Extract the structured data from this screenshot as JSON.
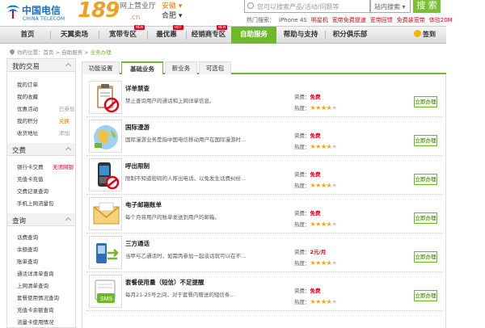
{
  "header": {
    "logo_cn": "中国电信",
    "logo_en": "CHINA TELECOM",
    "brand": "189",
    "brand_suffix": ".cn",
    "hall": "网上营业厅",
    "province": "安徽 ▾",
    "city": "合肥 ▾",
    "search_placeholder": "您可以搜索产品/活动/问题等",
    "search_scope": "站内搜索 ▾",
    "search_button": "搜 索",
    "hot_label": "热门搜索：",
    "hot_terms": [
      "iPhone 4S",
      "明星机",
      "宽带免费提速",
      "宽带回馈",
      "免费装宽带",
      "体验20M"
    ]
  },
  "nav": {
    "items": [
      "首页",
      "天翼卖场",
      "宽带专区",
      "最优惠",
      "经销商专区",
      "自助服务",
      "帮助与支持",
      "积分俱乐部"
    ],
    "tags": [
      "NEW",
      "HOT",
      "NEW"
    ],
    "sign": "签到"
  },
  "breadcrumb": {
    "prefix": "你的位置：首页 > 自助服务 > ",
    "current": "业务办理"
  },
  "sidebar": {
    "sections": [
      {
        "title": "我的交易",
        "links": [
          {
            "label": "我的订单",
            "note": ""
          },
          {
            "label": "我的收藏",
            "note": ""
          },
          {
            "label": "优惠活动",
            "note": "已参加"
          },
          {
            "label": "我的积分",
            "note": "兑换"
          },
          {
            "label": "收货地址",
            "note": "添加"
          }
        ]
      },
      {
        "title": "交费",
        "links": [
          {
            "label": "银行卡交费",
            "note": "无须网银"
          },
          {
            "label": "充值卡充值",
            "note": ""
          },
          {
            "label": "交费记录查询",
            "note": ""
          },
          {
            "label": "手机上网流量包",
            "note": ""
          }
        ]
      },
      {
        "title": "查询",
        "links": [
          {
            "label": "话费查询",
            "note": ""
          },
          {
            "label": "余额查询",
            "note": ""
          },
          {
            "label": "账单查询",
            "note": ""
          },
          {
            "label": "通话详清单查询",
            "note": ""
          },
          {
            "label": "上网清单查询",
            "note": ""
          },
          {
            "label": "套餐使用情况查询",
            "note": ""
          },
          {
            "label": "充值卡余额查询",
            "note": ""
          },
          {
            "label": "流量卡使用情况",
            "note": ""
          }
        ]
      }
    ]
  },
  "tabs": [
    "功能设置",
    "基础业务",
    "新业务",
    "可选包"
  ],
  "active_tab": "基础业务",
  "fee_label": "资费：",
  "heat_label": "热度：",
  "action_label": "立即办理",
  "services": [
    {
      "title": "详单禁查",
      "desc": "禁止查询用户的通话和上网详单信息。",
      "fee": "免费",
      "stars": 4,
      "icon": "clipboard-forbid-icon"
    },
    {
      "title": "国际漫游",
      "desc": "国际漫游业务是指中国电信移动用户在国际漫游时...",
      "fee": "免费",
      "stars": 4,
      "icon": "globe-map-icon"
    },
    {
      "title": "呼出限制",
      "desc": "限制不知道密码的人呼出电话，以免发生话费纠纷...",
      "fee": "免费",
      "stars": 4,
      "icon": "phone-forbid-icon"
    },
    {
      "title": "电子邮箱账单",
      "desc": "每个月将用户的账单发送到用户的邮箱。",
      "fee": "免费",
      "stars": 4,
      "icon": "email-envelope-icon"
    },
    {
      "title": "三方通话",
      "desc": "当甲与乙通话时，如需丙参加一起谈话就可以在不...",
      "fee": "2元/月",
      "stars": 4,
      "icon": "phone-conference-icon"
    },
    {
      "title": "套餐使用量（短信）不足提醒",
      "desc": "每月21-25号之间，对于套餐内赠送的短信条...",
      "fee": "免费",
      "stars": 4,
      "icon": "sms-icon"
    }
  ],
  "colors": {
    "accent_green": "#6eb92b",
    "brand_orange": "#f0a020",
    "red": "#e4001a",
    "logo_blue": "#1c6fc1"
  }
}
